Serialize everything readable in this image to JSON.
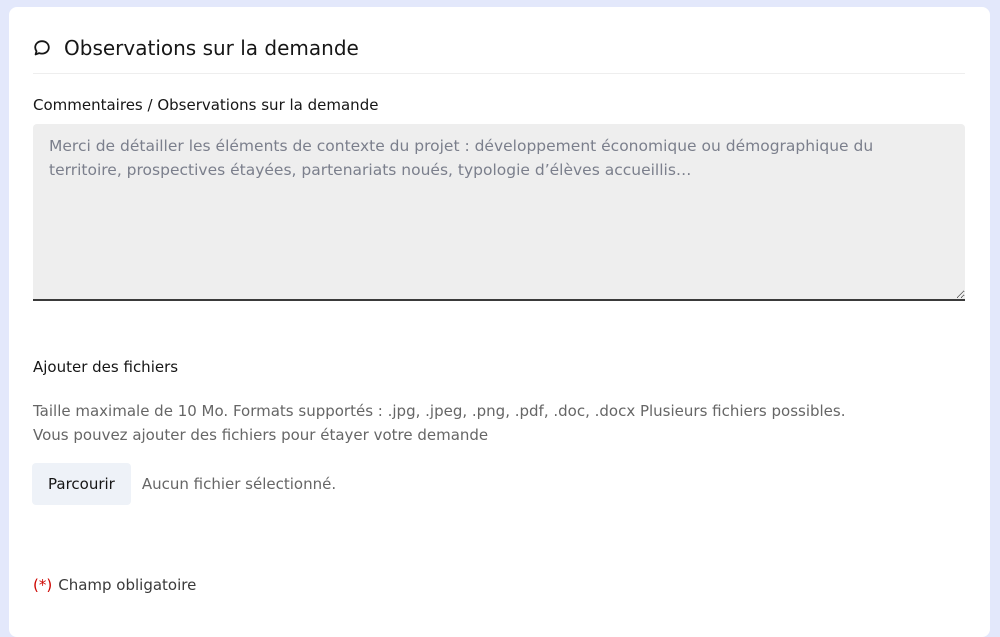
{
  "section": {
    "icon": "chat-bubble-icon",
    "title": "Observations sur la demande"
  },
  "comments": {
    "label": "Commentaires / Observations sur la demande",
    "value": "",
    "placeholder": "Merci de détailler les éléments de contexte du projet : développement économique ou démographique du territoire, prospectives étayées, partenariats noués, typologie d’élèves accueillis…"
  },
  "upload": {
    "label": "Ajouter des fichiers",
    "hint_line1": "Taille maximale de 10 Mo. Formats supportés : .jpg, .jpeg, .png, .pdf, .doc, .docx Plusieurs fichiers possibles.",
    "hint_line2": "Vous pouvez ajouter des fichiers pour étayer votre demande",
    "browse_label": "Parcourir",
    "status": "Aucun fichier sélectionné."
  },
  "required": {
    "marker": "(*)",
    "text": "Champ obligatoire"
  },
  "colors": {
    "page_background": "#e3e8fb",
    "card_background": "#ffffff",
    "textarea_background": "#eeeeee",
    "required_marker": "#ce0500",
    "button_background": "#eef2f8"
  }
}
